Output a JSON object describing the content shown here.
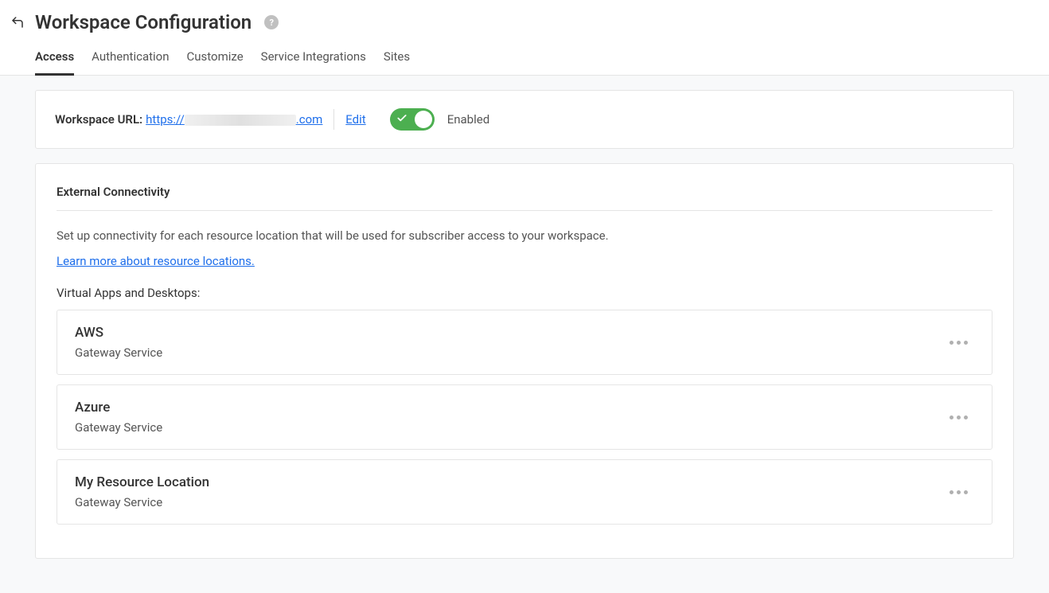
{
  "header": {
    "title": "Workspace Configuration"
  },
  "tabs": [
    {
      "label": "Access",
      "active": true
    },
    {
      "label": "Authentication",
      "active": false
    },
    {
      "label": "Customize",
      "active": false
    },
    {
      "label": "Service Integrations",
      "active": false
    },
    {
      "label": "Sites",
      "active": false
    }
  ],
  "workspace_url": {
    "label": "Workspace URL:",
    "prefix": "https://",
    "suffix": ".com",
    "edit_label": "Edit",
    "toggle_state": "Enabled"
  },
  "external_connectivity": {
    "title": "External Connectivity",
    "description": "Set up connectivity for each resource location that will be used for subscriber access to your workspace.",
    "learn_more": "Learn more about resource locations.",
    "subsection": "Virtual Apps and Desktops:",
    "resources": [
      {
        "name": "AWS",
        "type": "Gateway Service"
      },
      {
        "name": "Azure",
        "type": "Gateway Service"
      },
      {
        "name": "My Resource Location",
        "type": "Gateway Service"
      }
    ]
  }
}
